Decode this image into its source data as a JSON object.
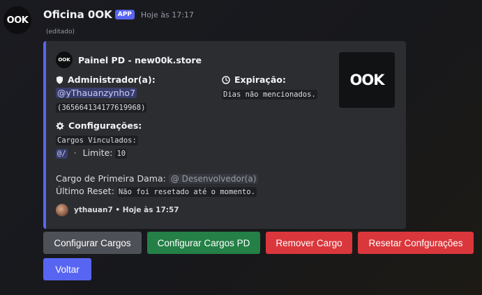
{
  "message": {
    "avatar_text": "OOK",
    "username": "Oficina 0OK",
    "badge": "APP",
    "timestamp": "Hoje às 17:17",
    "edited": "(editado)"
  },
  "embed": {
    "accent_color": "#5865f2",
    "author_icon_text": "OOK",
    "author": "Painel PD - new00k.store",
    "thumbnail_text": "OOK",
    "admin": {
      "title": "Administrador(a):",
      "mention": "@yThauanzynho7",
      "id": "(365664134177619968)"
    },
    "expiration": {
      "title": "Expiração:",
      "value": "Dias não mencionados."
    },
    "config": {
      "title": "Configurações:",
      "linked_roles_label": "Cargos Vinculados:",
      "linked_roles_value": "@/",
      "separator": "·",
      "limit_label": "Limite:",
      "limit_value": "10"
    },
    "first_lady": {
      "label": "Cargo de Primeira Dama:",
      "role": "@ Desenvolvedor(a)"
    },
    "last_reset": {
      "label": "Último Reset:",
      "value": "Não foi resetado até o momento."
    },
    "footer": {
      "text": "ythauan7 • Hoje às 17:57"
    }
  },
  "buttons": {
    "configure_roles": "Configurar Cargos",
    "configure_pd_roles": "Configurar Cargos PD",
    "remove_role": "Remover Cargo",
    "reset_settings": "Resetar Confgurações",
    "back": "Voltar"
  }
}
